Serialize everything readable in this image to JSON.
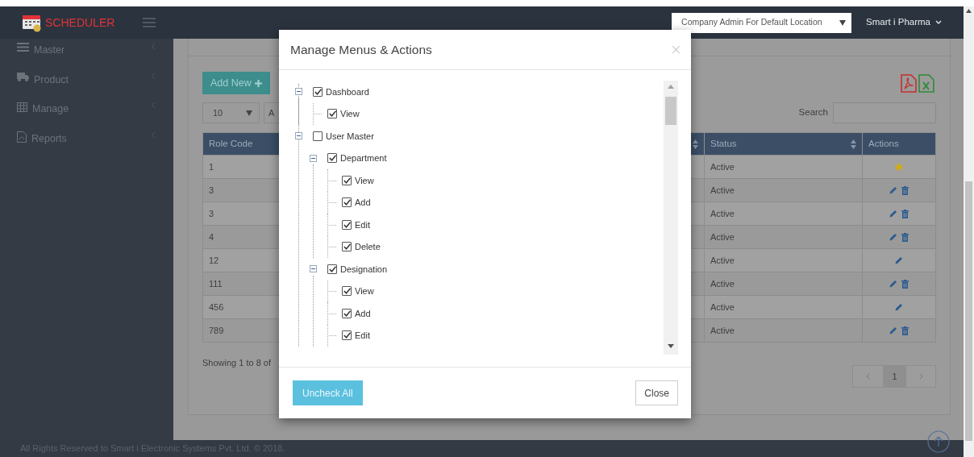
{
  "header": {
    "logo": "SCHEDULER",
    "role_select": "Company Admin For Default Location",
    "user_menu": "Smart i Pharma"
  },
  "sidebar": {
    "items": [
      {
        "label": "Master"
      },
      {
        "label": "Product"
      },
      {
        "label": "Manage"
      },
      {
        "label": "Reports"
      }
    ]
  },
  "toolbar": {
    "add_button": "Add New",
    "page_length": "10",
    "filter_field": "A",
    "search_label": "Search"
  },
  "table": {
    "columns": [
      "Role Code",
      "Status",
      "Actions"
    ],
    "rows": [
      {
        "role_code": "1",
        "status": "Active",
        "kind": "default"
      },
      {
        "role_code": "3",
        "status": "Active",
        "kind": "removable"
      },
      {
        "role_code": "3",
        "status": "Active",
        "kind": "removable"
      },
      {
        "role_code": "4",
        "status": "Active",
        "kind": "removable"
      },
      {
        "role_code": "12",
        "status": "Active",
        "kind": "editable"
      },
      {
        "role_code": "111",
        "status": "Active",
        "kind": "removable"
      },
      {
        "role_code": "456",
        "status": "Active",
        "kind": "editable"
      },
      {
        "role_code": "789",
        "status": "Active",
        "kind": "removable"
      }
    ]
  },
  "table_info": "Showing 1 to 8 of",
  "pagination": {
    "pages": [
      {
        "label": "1",
        "selected": true
      }
    ]
  },
  "modal": {
    "title": "Manage Menus & Actions",
    "tree": [
      {
        "label": "Dashboard",
        "checked": true,
        "expanded": true,
        "children": [
          {
            "label": "View",
            "checked": true
          }
        ]
      },
      {
        "label": "User Master",
        "checked": false,
        "expanded": true,
        "children": [
          {
            "label": "Department",
            "checked": true,
            "expanded": true,
            "children": [
              {
                "label": "View",
                "checked": true
              },
              {
                "label": "Add",
                "checked": true
              },
              {
                "label": "Edit",
                "checked": true
              },
              {
                "label": "Delete",
                "checked": true
              }
            ]
          },
          {
            "label": "Designation",
            "checked": true,
            "expanded": true,
            "children": [
              {
                "label": "View",
                "checked": true
              },
              {
                "label": "Add",
                "checked": true
              },
              {
                "label": "Edit",
                "checked": true
              }
            ]
          }
        ]
      }
    ],
    "buttons": [
      {
        "label": "Uncheck All",
        "kind": "primary"
      },
      {
        "label": "Close",
        "kind": "default"
      }
    ]
  },
  "footer": "All Rights Reserved to Smart i Electronic Systems Pvt. Ltd. © 2018."
}
